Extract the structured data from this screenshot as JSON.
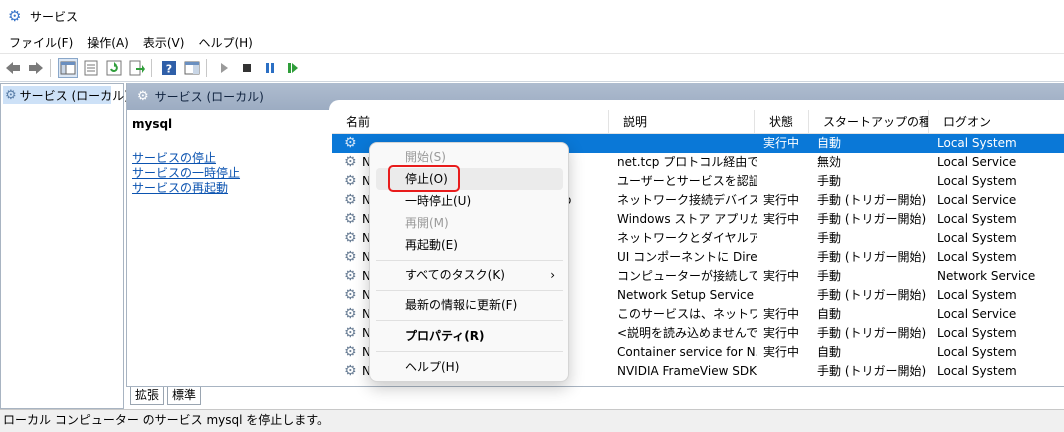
{
  "window": {
    "title": "サービス"
  },
  "menu": [
    "ファイル(F)",
    "操作(A)",
    "表示(V)",
    "ヘルプ(H)"
  ],
  "toolbar_icons": [
    "back-arrow-icon",
    "forward-arrow-icon",
    "console-tree-icon",
    "properties-icon",
    "refresh-icon",
    "export-icon",
    "help-icon",
    "show-hide-icon",
    "play-icon",
    "stop-icon",
    "pause-icon",
    "restart-icon"
  ],
  "tree": {
    "root_label": "サービス (ローカル)"
  },
  "pane": {
    "header": "サービス (ローカル)",
    "selected_service": "mysql",
    "links": [
      "サービスの停止",
      "サービスの一時停止",
      "サービスの再起動"
    ]
  },
  "columns": [
    "名前",
    "説明",
    "状態",
    "スタートアップの種類",
    "ログオン"
  ],
  "rows": [
    {
      "name": "",
      "desc": "",
      "status": "実行中",
      "startup": "自動",
      "logon": "Local System"
    },
    {
      "name": "N",
      "desc": "net.tcp プロトコル経由で ...",
      "status": "",
      "startup": "無効",
      "logon": "Local Service"
    },
    {
      "name": "N",
      "desc": "ユーザーとサービスを認証す...",
      "status": "",
      "startup": "手動",
      "logon": "Local System"
    },
    {
      "name": "N",
      "desc": "ネットワーク接続デバイス自...",
      "status": "実行中",
      "startup": "手動 (トリガー開始)",
      "logon": "Local Service"
    },
    {
      "name": "N",
      "desc": "Windows ストア アプリが...",
      "status": "実行中",
      "startup": "手動 (トリガー開始)",
      "logon": "Local System"
    },
    {
      "name": "N",
      "desc": "ネットワークとダイヤルアップ...",
      "status": "",
      "startup": "手動",
      "logon": "Local System"
    },
    {
      "name": "N",
      "desc": "UI コンポーネントに Direct...",
      "status": "",
      "startup": "手動 (トリガー開始)",
      "logon": "Local System"
    },
    {
      "name": "N",
      "desc": "コンピューターが接続してい...",
      "status": "実行中",
      "startup": "手動",
      "logon": "Network Service"
    },
    {
      "name": "N",
      "desc": "Network Setup Service ...",
      "status": "",
      "startup": "手動 (トリガー開始)",
      "logon": "Local System"
    },
    {
      "name": "N",
      "desc": "このサービスは、ネットワーク...",
      "status": "実行中",
      "startup": "自動",
      "logon": "Local Service"
    },
    {
      "name": "N",
      "desc": "<説明を読み込めませんで...",
      "status": "実行中",
      "startup": "手動 (トリガー開始)",
      "logon": "Local System"
    },
    {
      "name": "N",
      "desc": "Container service for N...",
      "status": "実行中",
      "startup": "自動",
      "logon": "Local System"
    },
    {
      "name": "N",
      "desc": "NVIDIA FrameView SDK ...",
      "status": "",
      "startup": "手動 (トリガー開始)",
      "logon": "Local System"
    }
  ],
  "row_fragment": "o",
  "context_menu": {
    "items": [
      "開始(S)",
      "停止(O)",
      "一時停止(U)",
      "再開(M)",
      "再起動(E)",
      "すべてのタスク(K)",
      "最新の情報に更新(F)",
      "プロパティ(R)",
      "ヘルプ(H)"
    ],
    "submenu_arrow": "›"
  },
  "tabs": [
    "拡張",
    "標準"
  ],
  "statusbar": "ローカル コンピューター のサービス mysql を停止します。"
}
